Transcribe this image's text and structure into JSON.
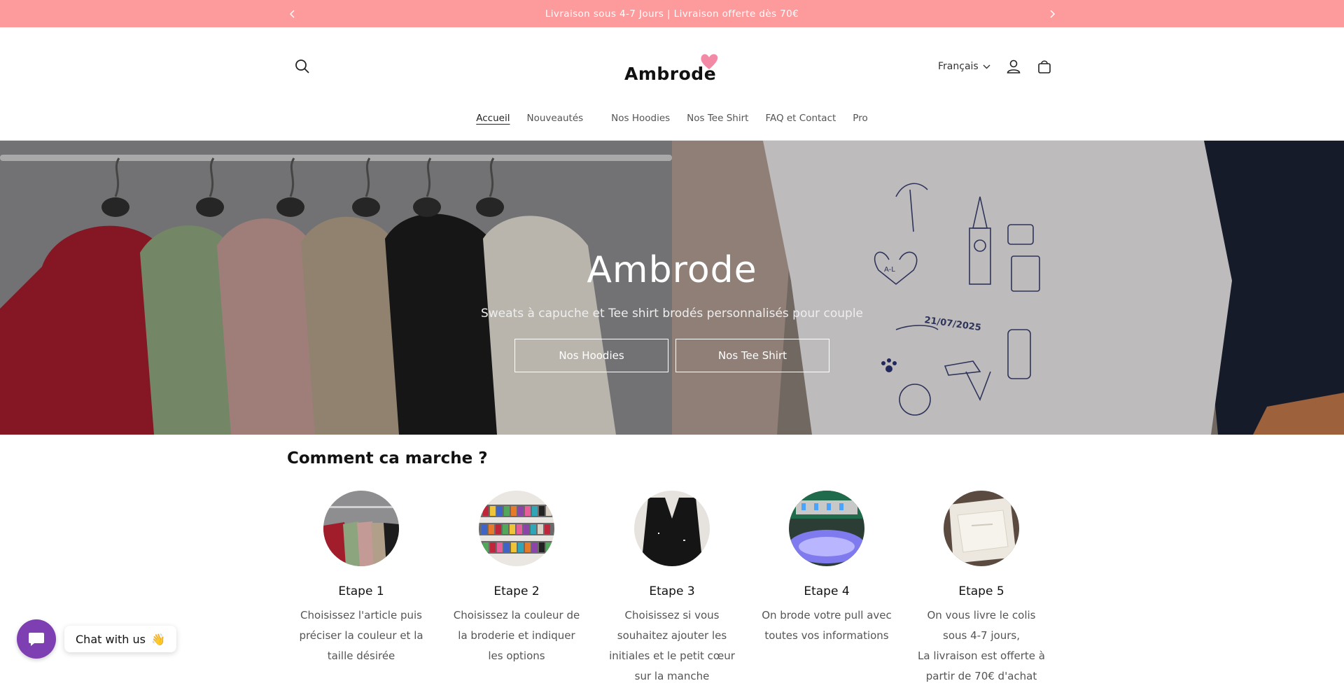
{
  "announcement": {
    "text": "Livraison sous 4-7 Jours | Livraison offerte dès 70€",
    "prev_icon": "chevron-left-icon",
    "next_icon": "chevron-right-icon",
    "background": "#fd9a9c"
  },
  "header": {
    "logo_text": "Ambrode",
    "language": "Français",
    "icons": {
      "search": "search-icon",
      "account": "user-icon",
      "cart": "shopping-bag-icon",
      "heart": "heart-icon"
    },
    "accent_color": "#f28aa6"
  },
  "nav": {
    "items": [
      {
        "label": "Accueil"
      },
      {
        "label": "Nouveautés"
      },
      {
        "label": "Nos Hoodies"
      },
      {
        "label": "Nos Tee Shirt"
      },
      {
        "label": "FAQ et Contact"
      },
      {
        "label": "Pro"
      }
    ]
  },
  "hero": {
    "title": "Ambrode",
    "subtitle": "Sweats à capuche et Tee shirt brodés personnalisés pour couple",
    "buttons": [
      {
        "label": "Nos Hoodies"
      },
      {
        "label": "Nos Tee Shirt"
      }
    ],
    "tshirt_date": "21/07/2025",
    "heart_initials": "A-L"
  },
  "steps": {
    "title": "Comment ca marche ?",
    "items": [
      {
        "title": "Etape 1",
        "lines": [
          "Choisissez l'article puis",
          "préciser la couleur et la",
          "taille désirée"
        ]
      },
      {
        "title": "Etape 2",
        "lines": [
          "Choisissez la couleur de",
          "la broderie et indiquer",
          "les options"
        ]
      },
      {
        "title": "Etape 3",
        "lines": [
          "Choisissez si vous",
          "souhaitez ajouter les",
          "initiales et le petit cœur",
          "sur la manche"
        ]
      },
      {
        "title": "Etape 4",
        "lines": [
          "On brode votre pull avec",
          "toutes vos informations"
        ]
      },
      {
        "title": "Etape 5",
        "lines": [
          "On vous livre le colis",
          "sous 4-7 jours,",
          "La livraison est offerte à",
          "partir de 70€ d'achat"
        ]
      }
    ]
  },
  "chat": {
    "label": "Chat with us",
    "emoji": "👋",
    "icon": "chat-bubble-icon",
    "color": "#7e3fb3"
  }
}
